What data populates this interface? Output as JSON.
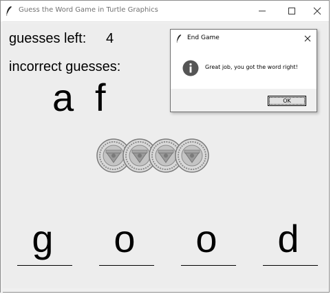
{
  "window": {
    "title": "Guess the Word Game in Turtle Graphics"
  },
  "game": {
    "guesses_left_label": "guesses left:",
    "guesses_left_value": "4",
    "incorrect_label": "incorrect guesses:",
    "incorrect_letters": [
      "a",
      "f"
    ],
    "word_letters": [
      "g",
      "o",
      "o",
      "d"
    ]
  },
  "dialog": {
    "title": "End Game",
    "message": "Great job, you got the word right!",
    "ok_label": "OK"
  },
  "icons": {
    "app": "feather-icon",
    "info": "info-icon",
    "coin": "coin-icon"
  },
  "colors": {
    "canvas": "#ededed",
    "info_icon": "#555555",
    "coin": "#8a8a8a"
  }
}
